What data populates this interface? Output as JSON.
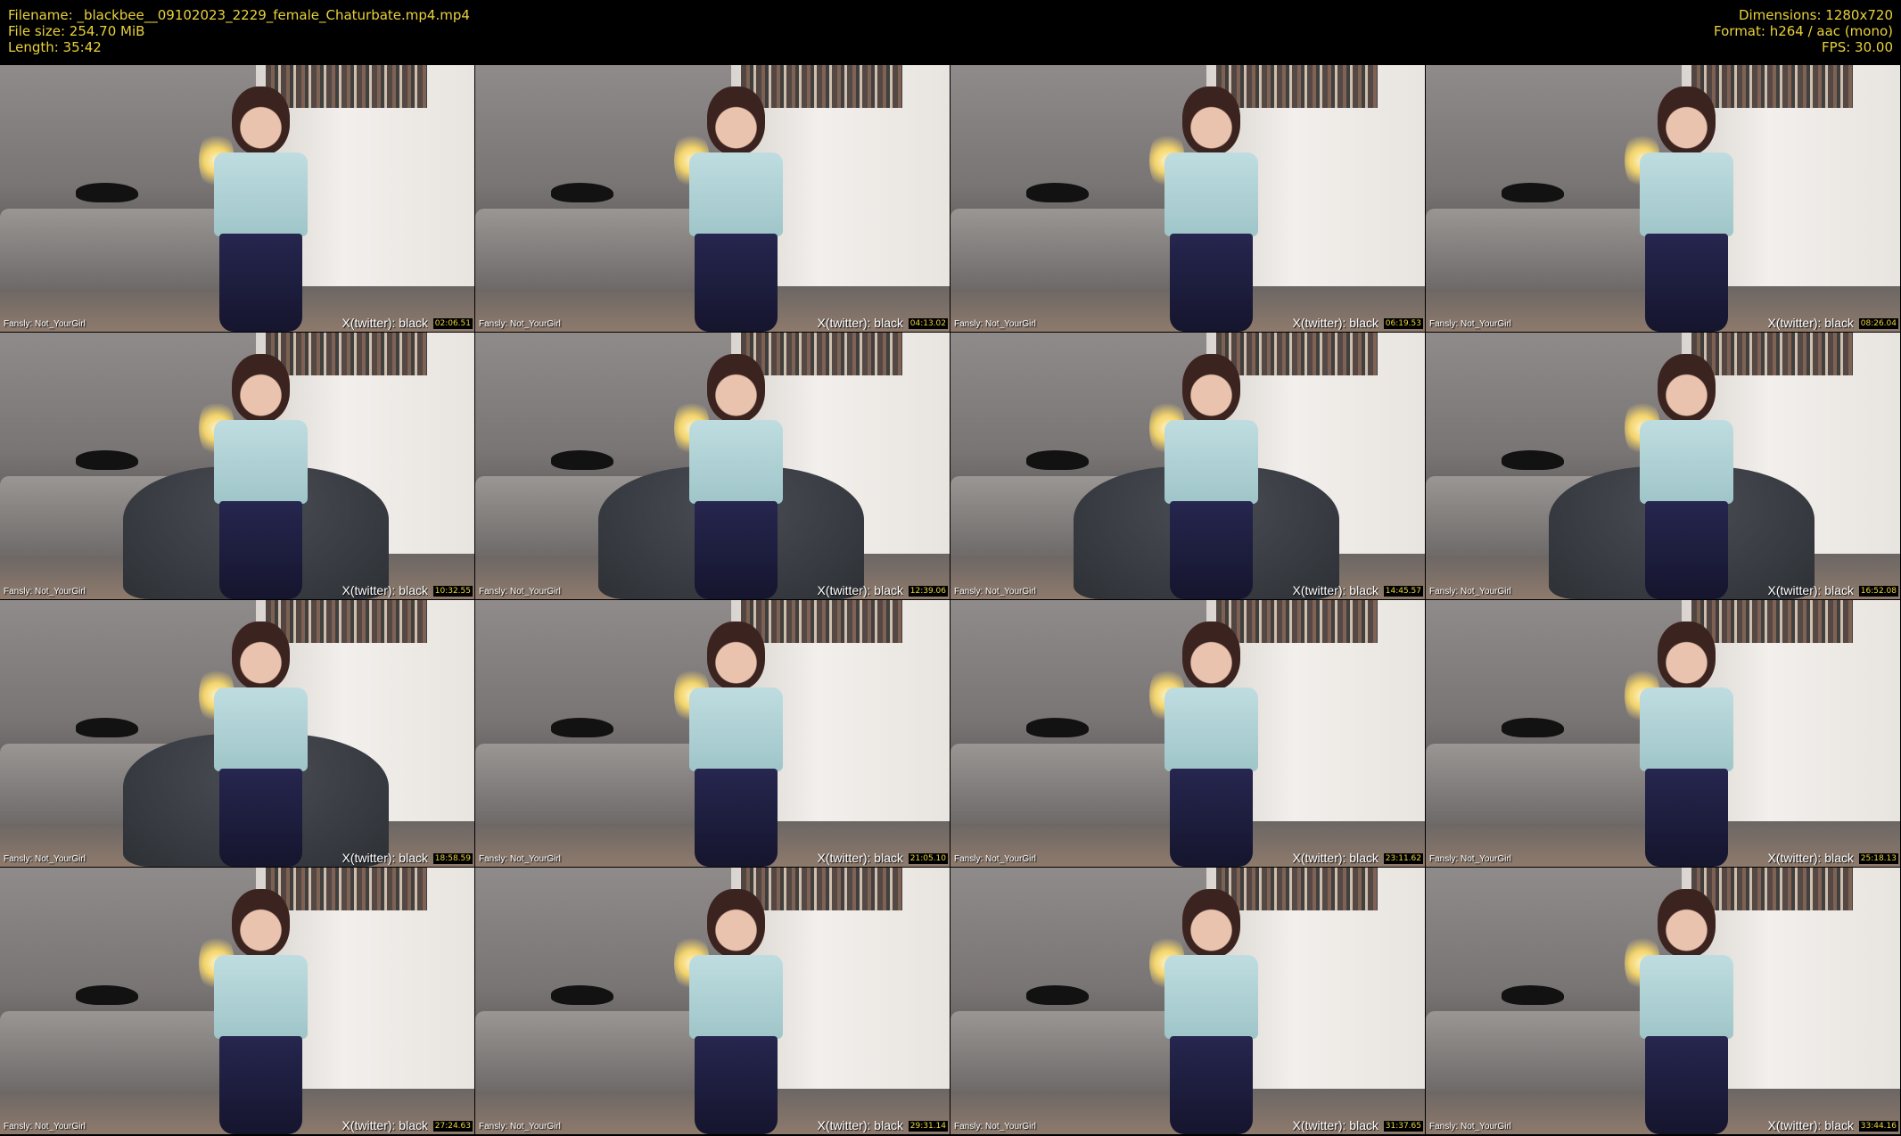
{
  "header": {
    "filename_line": "Filename: _blackbee__09102023_2229_female_Chaturbate.mp4.mp4",
    "filesize_line": "File size: 254.70 MiB",
    "length_line": "Length: 35:42",
    "dimensions_line": "Dimensions: 1280x720",
    "format_line": "Format: h264 / aac (mono)",
    "fps_line": "FPS: 30.00"
  },
  "thumbnails": [
    {
      "left_caption": "Fansly: Not_YourGirl",
      "right_caption": "X(twitter): black",
      "timestamp": "02:06.51",
      "scene": "standing"
    },
    {
      "left_caption": "Fansly: Not_YourGirl",
      "right_caption": "X(twitter): black",
      "timestamp": "04:13.02",
      "scene": "standing"
    },
    {
      "left_caption": "Fansly: Not_YourGirl",
      "right_caption": "X(twitter): black",
      "timestamp": "06:19.53",
      "scene": "back"
    },
    {
      "left_caption": "Fansly: Not_YourGirl",
      "right_caption": "X(twitter): black",
      "timestamp": "08:26.04",
      "scene": "leaning"
    },
    {
      "left_caption": "Fansly: Not_YourGirl",
      "right_caption": "X(twitter): black",
      "timestamp": "10:32.55",
      "scene": "chair"
    },
    {
      "left_caption": "Fansly: Not_YourGirl",
      "right_caption": "X(twitter): black",
      "timestamp": "12:39.06",
      "scene": "chair"
    },
    {
      "left_caption": "Fansly: Not_YourGirl",
      "right_caption": "X(twitter): black",
      "timestamp": "14:45.57",
      "scene": "chair"
    },
    {
      "left_caption": "Fansly: Not_YourGirl",
      "right_caption": "X(twitter): black",
      "timestamp": "16:52.08",
      "scene": "chair-closeup"
    },
    {
      "left_caption": "Fansly: Not_YourGirl",
      "right_caption": "X(twitter): black",
      "timestamp": "18:58.59",
      "scene": "chair"
    },
    {
      "left_caption": "Fansly: Not_YourGirl",
      "right_caption": "X(twitter): black",
      "timestamp": "21:05.10",
      "scene": "standing"
    },
    {
      "left_caption": "Fansly: Not_YourGirl",
      "right_caption": "X(twitter): black",
      "timestamp": "23:11.62",
      "scene": "room"
    },
    {
      "left_caption": "Fansly: Not_YourGirl",
      "right_caption": "X(twitter): black",
      "timestamp": "25:18.13",
      "scene": "standing"
    },
    {
      "left_caption": "Fansly: Not_YourGirl",
      "right_caption": "X(twitter): black",
      "timestamp": "27:24.63",
      "scene": "standing"
    },
    {
      "left_caption": "Fansly: Not_YourGirl",
      "right_caption": "X(twitter): black",
      "timestamp": "29:31.14",
      "scene": "standing"
    },
    {
      "left_caption": "Fansly: Not_YourGirl",
      "right_caption": "X(twitter): black",
      "timestamp": "31:37.65",
      "scene": "leaning"
    },
    {
      "left_caption": "Fansly: Not_YourGirl",
      "right_caption": "X(twitter): black",
      "timestamp": "33:44.16",
      "scene": "standing"
    }
  ]
}
